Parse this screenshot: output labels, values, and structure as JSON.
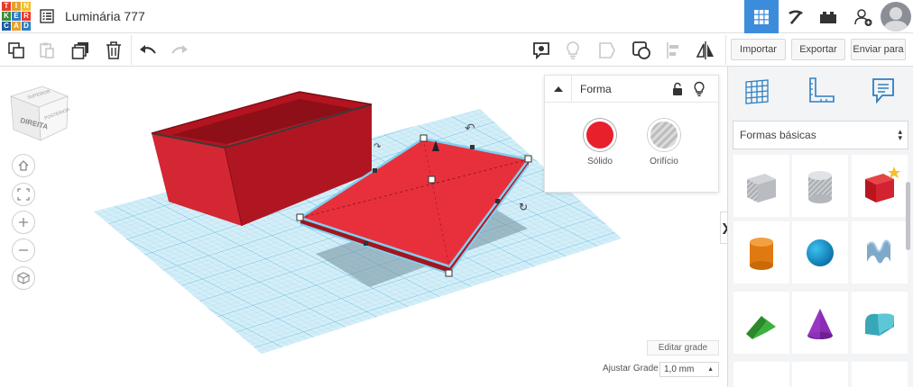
{
  "app": {
    "logo_letters": [
      "T",
      "I",
      "N",
      "K",
      "E",
      "R",
      "C",
      "A",
      "D"
    ],
    "logo_colors": [
      "#e63b2e",
      "#e6a02e",
      "#f1c02a",
      "#3b8c3a",
      "#2e7fc1",
      "#e63b2e",
      "#1c5fa4",
      "#e6a02e",
      "#2e7fc1"
    ],
    "design_title": "Luminária 777",
    "accent_color": "#3c8cdc"
  },
  "topbar": {
    "icons": [
      "design-list-icon",
      "grid-view-icon",
      "pickaxe-icon",
      "bricks-icon",
      "add-user-icon",
      "user-avatar"
    ]
  },
  "toolbar": {
    "icons": [
      "copy-icon",
      "paste-icon",
      "duplicate-icon",
      "delete-icon",
      "undo-icon",
      "redo-icon",
      "note-icon",
      "light-bulb-icon",
      "align-shape-icon",
      "group-icon",
      "align-icon",
      "mirror-icon"
    ],
    "import_label": "Importar",
    "export_label": "Exportar",
    "send_label": "Enviar para"
  },
  "viewcube": {
    "front_label": "DIREITA",
    "top_label": "SUPERIOR",
    "side_label": "POSTERIOR"
  },
  "view_controls": [
    "home-view-icon",
    "fit-view-icon",
    "zoom-in-icon",
    "zoom-out-icon",
    "ortho-view-icon"
  ],
  "inspector": {
    "title": "Forma",
    "solid_label": "Sólido",
    "hole_label": "Orifício",
    "solid_color": "#e8202c"
  },
  "grid": {
    "edit_label": "Editar grade",
    "snap_label": "Ajustar Grade",
    "snap_value": "1,0 mm"
  },
  "panel": {
    "toggle_glyph": "❯",
    "category": "Formas básicas",
    "tabs": [
      "workplane-grid-icon",
      "ruler-icon",
      "notes-icon"
    ],
    "shapes": [
      "box-hole",
      "cylinder-hole",
      "box",
      "cylinder",
      "sphere",
      "scribble",
      "roof",
      "cone",
      "round-roof"
    ]
  }
}
